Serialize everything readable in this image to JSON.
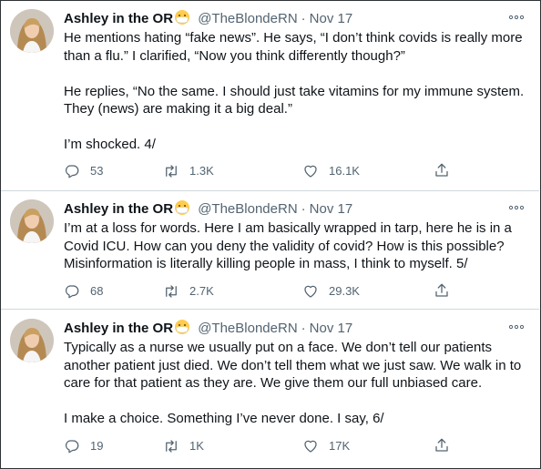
{
  "tweets": [
    {
      "name": "Ashley in the OR",
      "handle": "@TheBlondeRN",
      "separator": "·",
      "date": "Nov 17",
      "paragraphs": [
        "He mentions hating “fake news”. He says, “I don’t think covids is really more than a flu.” I clarified, “Now you think differently though?”",
        "He replies, “No the same. I should just take vitamins for my immune system. They (news) are making it a big deal.”",
        "I’m shocked. 4/"
      ],
      "replies": "53",
      "retweets": "1.3K",
      "likes": "16.1K"
    },
    {
      "name": "Ashley in the OR",
      "handle": "@TheBlondeRN",
      "separator": "·",
      "date": "Nov 17",
      "paragraphs": [
        "I’m at a loss for words. Here I am basically wrapped in tarp, here he is in a Covid ICU. How can you deny the validity of covid? How is this possible? Misinformation is literally killing people in mass,  I think to myself. 5/"
      ],
      "replies": "68",
      "retweets": "2.7K",
      "likes": "29.3K"
    },
    {
      "name": "Ashley in the OR",
      "handle": "@TheBlondeRN",
      "separator": "·",
      "date": "Nov 17",
      "paragraphs": [
        "Typically as a nurse we usually put on a face. We don’t tell our patients another patient just died. We don’t tell them what we just saw. We walk in to care for that patient as they are. We give them our full unbiased care.",
        "I make a choice. Something I’ve never done. I say, 6/"
      ],
      "replies": "19",
      "retweets": "1K",
      "likes": "17K"
    }
  ],
  "icons": {
    "avatar": "profile-photo",
    "name_emoji": "face-with-medical-mask-icon",
    "more": "more-options-icon",
    "reply": "reply-icon",
    "retweet": "retweet-icon",
    "like": "heart-icon",
    "share": "share-icon"
  },
  "colors": {
    "text": "#0f1419",
    "secondary": "#536471",
    "divider": "#cfd9de"
  }
}
